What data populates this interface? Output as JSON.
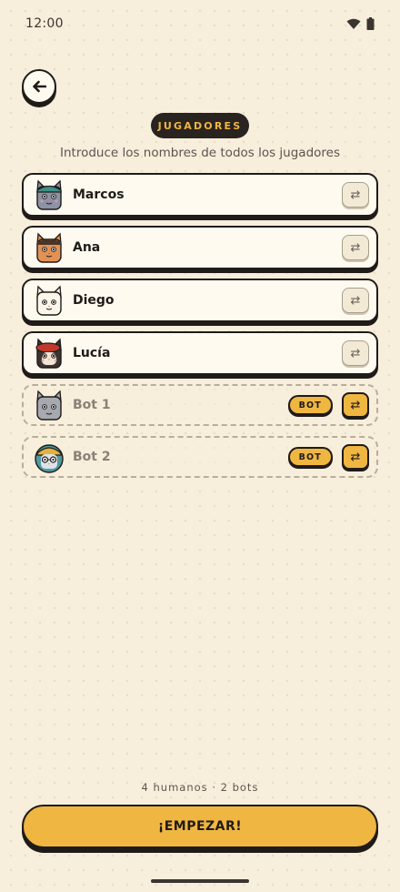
{
  "status_bar": {
    "time": "12:00"
  },
  "header": {
    "title": "JUGADORES",
    "subtitle": "Introduce los nombres de todos los jugadores"
  },
  "players": [
    {
      "name": "Marcos",
      "is_bot": false,
      "avatar": "cat-blue-gray-cap",
      "swap_icon": "⇄"
    },
    {
      "name": "Ana",
      "is_bot": false,
      "avatar": "cat-orange",
      "swap_icon": "⇄"
    },
    {
      "name": "Diego",
      "is_bot": false,
      "avatar": "cat-white",
      "swap_icon": "⇄"
    },
    {
      "name": "Lucía",
      "is_bot": false,
      "avatar": "cat-black-red-beret",
      "swap_icon": "⇄"
    },
    {
      "name": "Bot 1",
      "is_bot": true,
      "badge": "BOT",
      "avatar": "cat-gray",
      "swap_icon": "⇄"
    },
    {
      "name": "Bot 2",
      "is_bot": true,
      "badge": "BOT",
      "avatar": "cat-teal-glasses-beanie",
      "swap_icon": "⇄"
    }
  ],
  "summary": "4 humanos · 2 bots",
  "start_button": {
    "label": "¡EMPEZAR!"
  },
  "colors": {
    "background": "#f8eedc",
    "accent": "#f0b642",
    "ink": "#1f1b18",
    "card": "#fffaf0"
  }
}
